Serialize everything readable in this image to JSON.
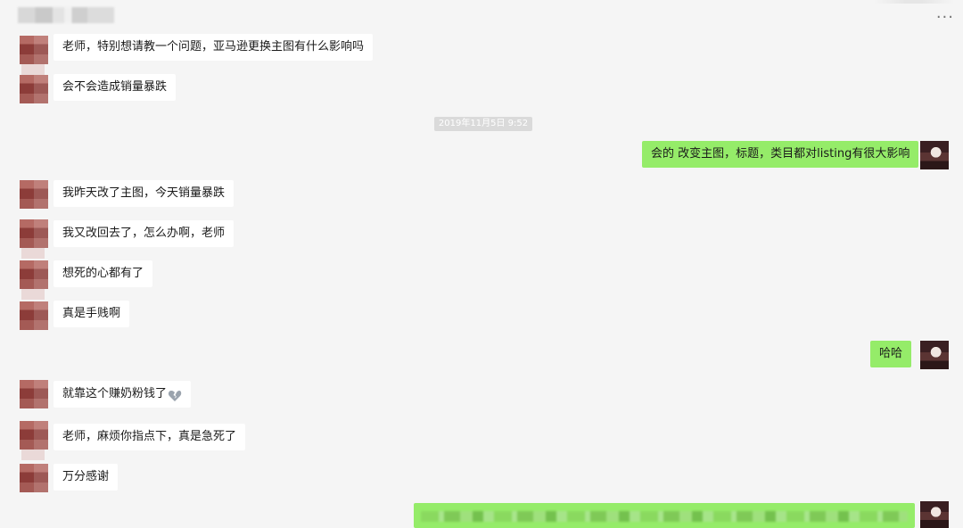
{
  "window": {
    "more_label": "···"
  },
  "timestamp": "2019年11月5日 9:52",
  "messages": {
    "m1": "老师，特别想请教一个问题，亚马逊更换主图有什么影响吗",
    "m2": "会不会造成销量暴跌",
    "m3": "会的 改变主图，标题，类目都对listing有很大影响",
    "m4": "我昨天改了主图，今天销量暴跌",
    "m5": "我又改回去了，怎么办啊，老师",
    "m6": "想死的心都有了",
    "m7": "真是手贱啊",
    "m8": "哈哈",
    "m9": "就靠这个赚奶粉钱了",
    "m10": "老师，麻烦你指点下，真是急死了",
    "m11": "万分感谢"
  },
  "icons": {
    "more": "more-icon",
    "broken_heart": "broken-heart-icon"
  },
  "colors": {
    "background": "#f5f5f5",
    "bubble_left": "#ffffff",
    "bubble_right": "#95ec69"
  }
}
